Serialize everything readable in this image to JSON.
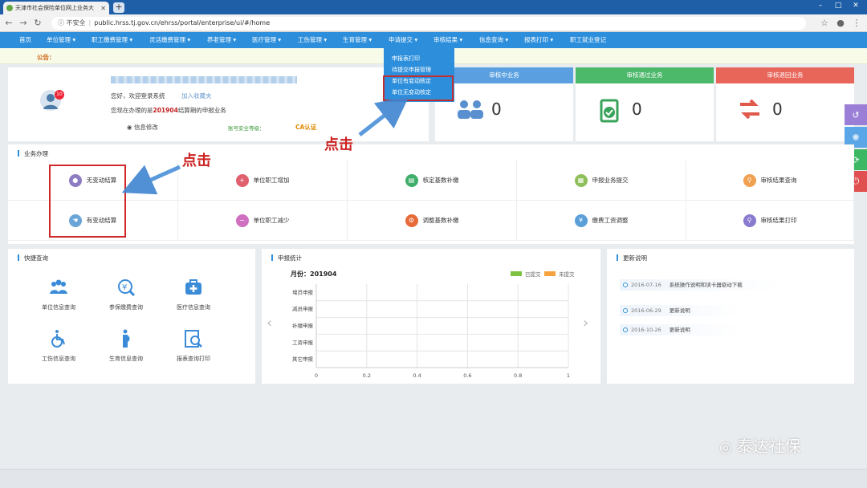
{
  "browser": {
    "tab_title": "天津市社会保险单位网上业务大",
    "new_tab": "+",
    "security_label": "不安全",
    "url": "public.hrss.tj.gov.cn/ehrss/portal/enterprise/ui/#/home"
  },
  "nav": {
    "items": [
      "首页",
      "单位管理 ▾",
      "职工缴费管理 ▾",
      "灵活缴费管理 ▾",
      "养老管理 ▾",
      "医疗管理 ▾",
      "工伤管理 ▾",
      "生育管理 ▾",
      "申请提交 ▾",
      "审核结果 ▾",
      "信息查询 ▾",
      "报表打印 ▾",
      "职工就业登记"
    ]
  },
  "notice": {
    "label": "公告："
  },
  "dropdown": {
    "items": [
      "申报表打印",
      "待提交申报管理",
      "单位有变动核定",
      "单位无变动核定"
    ]
  },
  "user": {
    "greeting": "您好，欢迎登录系统",
    "favorite_link": "加入收藏夹",
    "period_prefix": "您现在办理的是",
    "period": "201904",
    "period_suffix": "结算期的申报业务",
    "badge": "10",
    "info_edit": "信息修改",
    "security_level": "账号安全等级：",
    "ca": "CA认证"
  },
  "stats": [
    {
      "title": "审核中业务",
      "value": "0",
      "color": "#5aa0e0"
    },
    {
      "title": "审核通过业务",
      "value": "0",
      "color": "#4cb86a"
    },
    {
      "title": "审核退回业务",
      "value": "0",
      "color": "#e8655a"
    }
  ],
  "business": {
    "title": "业务办理",
    "items": [
      {
        "label": "无变动结算",
        "color": "#8e7cc3",
        "icon": "user-icon"
      },
      {
        "label": "单位职工增加",
        "color": "#e06070",
        "icon": "user-add-icon"
      },
      {
        "label": "核定基数补缴",
        "color": "#3fae6a",
        "icon": "card-icon"
      },
      {
        "label": "申报业务提交",
        "color": "#8fbf5a",
        "icon": "document-icon"
      },
      {
        "label": "审核结果查询",
        "color": "#f0a050",
        "icon": "search-icon"
      },
      {
        "label": "有变动结算",
        "color": "#6aa5d8",
        "icon": "hand-icon"
      },
      {
        "label": "单位职工减少",
        "color": "#d070c0",
        "icon": "user-remove-icon"
      },
      {
        "label": "调整基数补缴",
        "color": "#e86a3a",
        "icon": "gear-icon"
      },
      {
        "label": "缴费工资调整",
        "color": "#5a9fd8",
        "icon": "money-icon"
      },
      {
        "label": "审核结果打印",
        "color": "#8a7ad0",
        "icon": "print-icon"
      }
    ]
  },
  "quick": {
    "title": "快捷查询",
    "items": [
      "单位信息查询",
      "参保缴费查询",
      "医疗信息查询",
      "工伤信息查询",
      "生育信息查询",
      "报表查询打印"
    ]
  },
  "chart_panel": {
    "title": "申报统计",
    "month_label": "月份：",
    "month": "201904"
  },
  "chart_data": {
    "type": "bar",
    "orientation": "horizontal",
    "categories": [
      "增员申报",
      "减员申报",
      "补缴申报",
      "工资申报",
      "其它申报"
    ],
    "series": [
      {
        "name": "已提交",
        "color": "#7dc242",
        "values": [
          0,
          0,
          0,
          0,
          0
        ]
      },
      {
        "name": "未提交",
        "color": "#f4a340",
        "values": [
          0,
          0,
          0,
          0,
          0
        ]
      }
    ],
    "xlim": [
      0,
      1
    ],
    "xticks": [
      "0",
      "0.2",
      "0.4",
      "0.6",
      "0.8",
      "1"
    ],
    "grid": true,
    "legend": "top-right"
  },
  "updates": {
    "title": "更新说明",
    "items": [
      {
        "date": "2016-07-16",
        "text": "系统操作说明和读卡器驱动下载"
      },
      {
        "date": "2016-06-29",
        "text": "更新说明"
      },
      {
        "date": "2016-10-26",
        "text": "更新说明"
      }
    ]
  },
  "annotations": {
    "click1": "点击",
    "click2": "点击"
  },
  "watermark": "泰达社保"
}
